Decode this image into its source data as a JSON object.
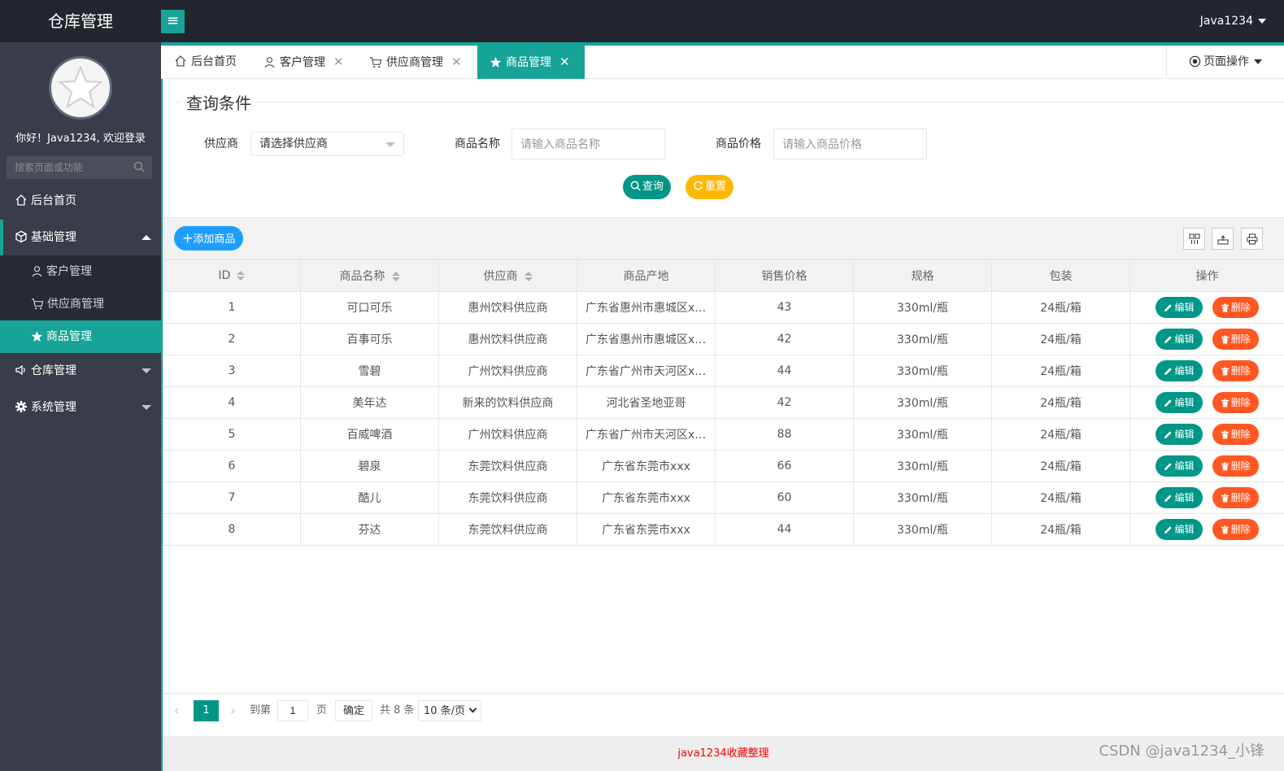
{
  "header": {
    "app_title": "仓库管理",
    "menu_toggle_glyph": "≡",
    "user": "Java1234"
  },
  "sidebar": {
    "welcome": "你好！Java1234, 欢迎登录",
    "search_placeholder": "搜索页面或功能",
    "items": [
      {
        "label": "后台首页",
        "icon": "home-icon"
      },
      {
        "label": "基础管理",
        "icon": "cube-icon",
        "expanded": true
      },
      {
        "label": "仓库管理",
        "icon": "speaker-icon"
      },
      {
        "label": "系统管理",
        "icon": "gear-icon"
      }
    ],
    "subitems": [
      {
        "label": "客户管理",
        "icon": "user-icon"
      },
      {
        "label": "供应商管理",
        "icon": "cart-icon"
      },
      {
        "label": "商品管理",
        "icon": "star-icon",
        "active": true
      }
    ]
  },
  "tabs": [
    {
      "label": "后台首页",
      "icon": "home-icon",
      "closable": false
    },
    {
      "label": "客户管理",
      "icon": "user-icon",
      "closable": true
    },
    {
      "label": "供应商管理",
      "icon": "cart-icon",
      "closable": true
    },
    {
      "label": "商品管理",
      "icon": "star-icon",
      "closable": true,
      "active": true
    }
  ],
  "tab_close_glyph": "✕",
  "page_ops_label": "页面操作",
  "query": {
    "legend": "查询条件",
    "supplier_label": "供应商",
    "supplier_value": "请选择供应商",
    "name_label": "商品名称",
    "name_placeholder": "请输入商品名称",
    "price_label": "商品价格",
    "price_placeholder": "请输入商品价格",
    "search_btn": "查询",
    "reset_btn": "重置"
  },
  "toolbar": {
    "add_btn": "添加商品"
  },
  "table": {
    "columns": [
      "ID",
      "商品名称",
      "供应商",
      "商品产地",
      "销售价格",
      "规格",
      "包装",
      "操作"
    ],
    "edit_label": "编辑",
    "delete_label": "删除",
    "rows": [
      {
        "id": "1",
        "name": "可口可乐",
        "supplier": "惠州饮料供应商",
        "origin": "广东省惠州市惠城区xxx",
        "price": "43",
        "spec": "330ml/瓶",
        "pack": "24瓶/箱"
      },
      {
        "id": "2",
        "name": "百事可乐",
        "supplier": "惠州饮料供应商",
        "origin": "广东省惠州市惠城区xxx",
        "price": "42",
        "spec": "330ml/瓶",
        "pack": "24瓶/箱"
      },
      {
        "id": "3",
        "name": "雪碧",
        "supplier": "广州饮料供应商",
        "origin": "广东省广州市天河区xxx",
        "price": "44",
        "spec": "330ml/瓶",
        "pack": "24瓶/箱"
      },
      {
        "id": "4",
        "name": "美年达",
        "supplier": "新来的饮料供应商",
        "origin": "河北省圣地亚哥",
        "price": "42",
        "spec": "330ml/瓶",
        "pack": "24瓶/箱"
      },
      {
        "id": "5",
        "name": "百威啤酒",
        "supplier": "广州饮料供应商",
        "origin": "广东省广州市天河区xxx",
        "price": "88",
        "spec": "330ml/瓶",
        "pack": "24瓶/箱"
      },
      {
        "id": "6",
        "name": "碧泉",
        "supplier": "东莞饮料供应商",
        "origin": "广东省东莞市xxx",
        "price": "66",
        "spec": "330ml/瓶",
        "pack": "24瓶/箱"
      },
      {
        "id": "7",
        "name": "酷儿",
        "supplier": "东莞饮料供应商",
        "origin": "广东省东莞市xxx",
        "price": "60",
        "spec": "330ml/瓶",
        "pack": "24瓶/箱"
      },
      {
        "id": "8",
        "name": "芬达",
        "supplier": "东莞饮料供应商",
        "origin": "广东省东莞市xxx",
        "price": "44",
        "spec": "330ml/瓶",
        "pack": "24瓶/箱"
      }
    ]
  },
  "pager": {
    "prev": "‹",
    "current": "1",
    "next": "›",
    "goto_label": "到第",
    "goto_value": "1",
    "page_unit": "页",
    "confirm": "确定",
    "total": "共 8 条",
    "page_size": "10 条/页"
  },
  "footer": {
    "text": "java1234收藏整理",
    "watermark": "CSDN @java1234_小锋"
  },
  "colors": {
    "accent": "#17a398",
    "sidebar_bg": "#393d49",
    "header_bg": "#23262e",
    "edit": "#009688",
    "delete": "#ff5722",
    "add": "#1e9fff",
    "reset": "#ffb800"
  }
}
